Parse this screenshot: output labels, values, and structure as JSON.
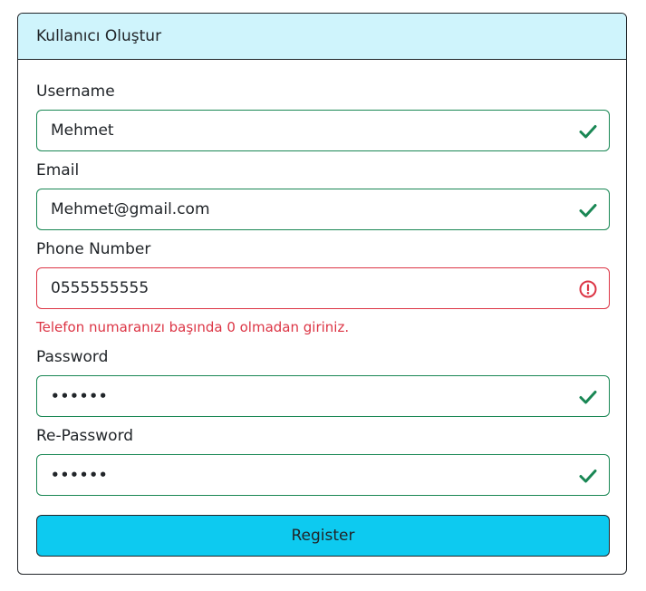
{
  "header": {
    "title": "Kullanıcı Oluştur"
  },
  "form": {
    "username": {
      "label": "Username",
      "value": "Mehmet",
      "state": "valid"
    },
    "email": {
      "label": "Email",
      "value": "Mehmet@gmail.com",
      "state": "valid"
    },
    "phone": {
      "label": "Phone Number",
      "value": "0555555555",
      "state": "invalid",
      "error": "Telefon numaranızı başında 0 olmadan giriniz."
    },
    "password": {
      "label": "Password",
      "value": "••••••",
      "state": "valid"
    },
    "repassword": {
      "label": "Re-Password",
      "value": "••••••",
      "state": "valid"
    }
  },
  "submit": {
    "label": "Register"
  },
  "colors": {
    "header_bg": "#cff4fc",
    "valid": "#198754",
    "invalid": "#dc3545",
    "button_bg": "#0dcaf0"
  },
  "icons": {
    "valid": "check-icon",
    "invalid": "exclamation-circle-icon"
  }
}
